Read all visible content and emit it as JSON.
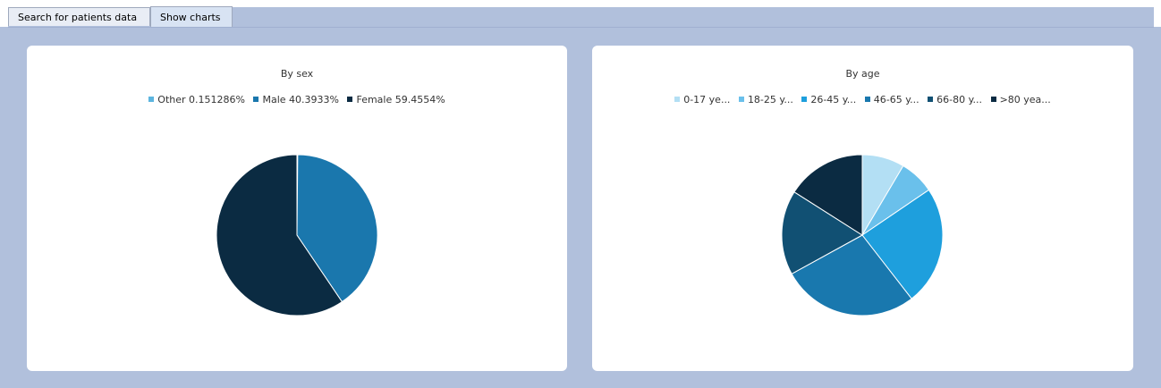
{
  "tabs": [
    {
      "label": "Search for patients data",
      "active": false
    },
    {
      "label": "Show charts",
      "active": true
    }
  ],
  "colors": {
    "background": "#b1c0dc",
    "panel": "#ffffff"
  },
  "chart_data": [
    {
      "type": "pie",
      "title": "By sex",
      "legend_position": "top",
      "categories": [
        "Other",
        "Male",
        "Female"
      ],
      "legend_labels": [
        "Other 0.151286%",
        "Male 40.3933%",
        "Female 59.4554%"
      ],
      "values": [
        0.151286,
        40.3933,
        59.4554
      ],
      "colors": [
        "#5cb5df",
        "#1a77ad",
        "#0b2b42"
      ]
    },
    {
      "type": "pie",
      "title": "By age",
      "legend_position": "top",
      "categories": [
        "0-17 ye...",
        "18-25 y...",
        "26-45 y...",
        "46-65 y...",
        "66-80 y...",
        ">80 yea..."
      ],
      "legend_labels": [
        "0-17 ye...",
        "18-25 y...",
        "26-45 y...",
        "46-65 y...",
        "66-80 y...",
        ">80 yea..."
      ],
      "values": [
        8.5,
        7.0,
        24.0,
        27.5,
        17.0,
        16.0
      ],
      "colors": [
        "#b3dff4",
        "#6ac0eb",
        "#1e9fdd",
        "#1978ae",
        "#115073",
        "#0b2b42"
      ]
    }
  ]
}
